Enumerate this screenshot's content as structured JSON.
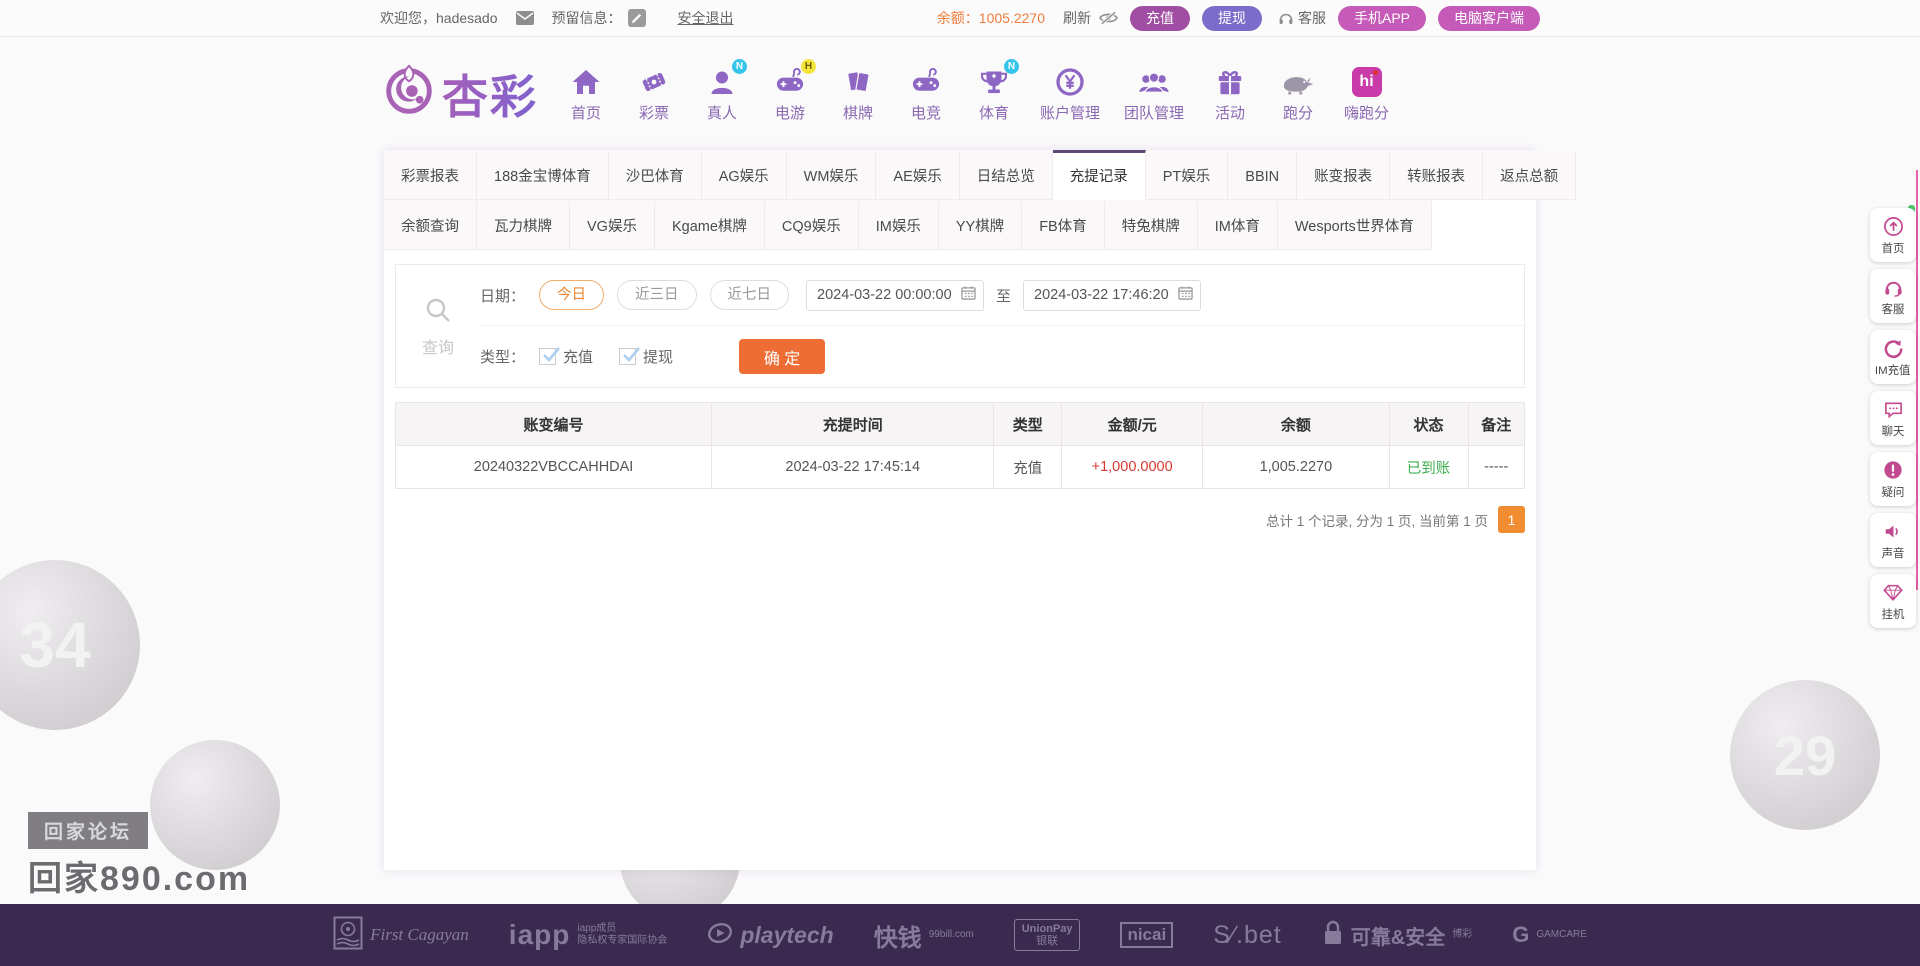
{
  "topbar": {
    "welcome": "欢迎您，hadesado",
    "reserved_label": "预留信息：",
    "logout": "安全退出",
    "balance_label": "余额：",
    "balance_value": "1005.2270",
    "refresh": "刷新",
    "deposit": "充值",
    "withdraw": "提现",
    "service": "客服",
    "mobile_app": "手机APP",
    "pc_client": "电脑客户端"
  },
  "brand": {
    "logo_text": "杏彩"
  },
  "nav": {
    "items": [
      {
        "id": "home",
        "label": "首页",
        "icon": "home-icon",
        "badge": ""
      },
      {
        "id": "lottery",
        "label": "彩票",
        "icon": "ticket-icon",
        "badge": ""
      },
      {
        "id": "live",
        "label": "真人",
        "icon": "person-icon",
        "badge": "N"
      },
      {
        "id": "egames",
        "label": "电游",
        "icon": "gamepad-icon",
        "badge": "H"
      },
      {
        "id": "chess",
        "label": "棋牌",
        "icon": "cards-icon",
        "badge": ""
      },
      {
        "id": "esports",
        "label": "电竞",
        "icon": "gamepad2-icon",
        "badge": ""
      },
      {
        "id": "sports",
        "label": "体育",
        "icon": "trophy-icon",
        "badge": "N"
      },
      {
        "id": "account",
        "label": "账户管理",
        "icon": "coin-icon",
        "badge": ""
      },
      {
        "id": "team",
        "label": "团队管理",
        "icon": "team-icon",
        "badge": ""
      },
      {
        "id": "activity",
        "label": "活动",
        "icon": "gift-icon",
        "badge": ""
      },
      {
        "id": "paofen",
        "label": "跑分",
        "icon": "rhino-icon",
        "badge": ""
      },
      {
        "id": "hipaofen",
        "label": "嗨跑分",
        "icon": "hi-icon",
        "badge": ""
      }
    ]
  },
  "tabs": {
    "row1": [
      "彩票报表",
      "188金宝博体育",
      "沙巴体育",
      "AG娱乐",
      "WM娱乐",
      "AE娱乐",
      "日结总览",
      "充提记录",
      "PT娱乐",
      "BBIN",
      "账变报表",
      "转账报表",
      "返点总额"
    ],
    "row1_active": "充提记录",
    "row2": [
      "余额查询",
      "瓦力棋牌",
      "VG娱乐",
      "Kgame棋牌",
      "CQ9娱乐",
      "IM娱乐",
      "YY棋牌",
      "FB体育",
      "特兔棋牌",
      "IM体育",
      "Wesports世界体育"
    ]
  },
  "search": {
    "query_label": "查询",
    "date_label": "日期：",
    "quick": [
      "今日",
      "近三日",
      "近七日"
    ],
    "quick_active": "今日",
    "date_from": "2024-03-22 00:00:00",
    "to_label": "至",
    "date_to": "2024-03-22 17:46:20",
    "type_label": "类型：",
    "types": [
      {
        "label": "充值",
        "checked": true
      },
      {
        "label": "提现",
        "checked": true
      }
    ],
    "submit": "确 定"
  },
  "table": {
    "headers": [
      "账变编号",
      "充提时间",
      "类型",
      "金额/元",
      "余额",
      "状态",
      "备注"
    ],
    "rows": [
      [
        "20240322VBCCAHHDAI",
        "2024-03-22 17:45:14",
        "充值",
        "+1,000.0000",
        "1,005.2270",
        "已到账",
        "-----"
      ]
    ]
  },
  "pagination": {
    "summary": "总计 1 个记录, 分为 1 页, 当前第 1 页",
    "current_page": "1"
  },
  "sidebar": {
    "items": [
      {
        "id": "top",
        "icon": "top-icon",
        "label": "首页"
      },
      {
        "id": "service",
        "icon": "headset-icon",
        "label": "客服"
      },
      {
        "id": "im-recharge",
        "icon": "refresh-icon",
        "label": "IM充值"
      },
      {
        "id": "chat",
        "icon": "chat-icon",
        "label": "聊天"
      },
      {
        "id": "question",
        "icon": "exclaim-icon",
        "label": "疑问"
      },
      {
        "id": "sound",
        "icon": "speaker-icon",
        "label": "声音"
      },
      {
        "id": "hangup",
        "icon": "gem-icon",
        "label": "挂机"
      }
    ]
  },
  "footer": {
    "logos": [
      {
        "id": "first-cagayan",
        "icon": "stamp-icon",
        "main": "First Cagayan",
        "sub1": "",
        "sub2": ""
      },
      {
        "id": "iapp",
        "icon": "",
        "main": "iapp",
        "sub1": "iapp成员",
        "sub2": "隐私权专家国际协会"
      },
      {
        "id": "playtech",
        "icon": "play-icon",
        "main": "playtech",
        "sub1": "",
        "sub2": ""
      },
      {
        "id": "kuaiqian",
        "icon": "",
        "main": "快钱",
        "sub1": "99bill.com",
        "sub2": ""
      },
      {
        "id": "unionpay",
        "icon": "",
        "main": "UnionPay",
        "sub1": "银联",
        "sub2": ""
      },
      {
        "id": "nicai",
        "icon": "",
        "main": "nicai",
        "sub1": "",
        "sub2": ""
      },
      {
        "id": "sbet",
        "icon": "",
        "main": "S∕.bet",
        "sub1": "",
        "sub2": ""
      },
      {
        "id": "secure",
        "icon": "lock-icon",
        "main": "可靠&安全",
        "sub1": "博彩",
        "sub2": ""
      },
      {
        "id": "gamcare",
        "icon": "",
        "main": "G",
        "sub1": "GAMCARE",
        "sub2": ""
      }
    ]
  },
  "decor": {
    "ball_number_left": "34",
    "ball_number_right": "29",
    "watermark_bar": "回家论坛",
    "watermark_site": "回家890.com"
  },
  "colors": {
    "accent_orange": "#ee6d35",
    "brand_purple": "#8b5cbf",
    "amount_red": "#d43a30",
    "status_green": "#3fae4d",
    "footer_bg": "#3a2a4f"
  }
}
